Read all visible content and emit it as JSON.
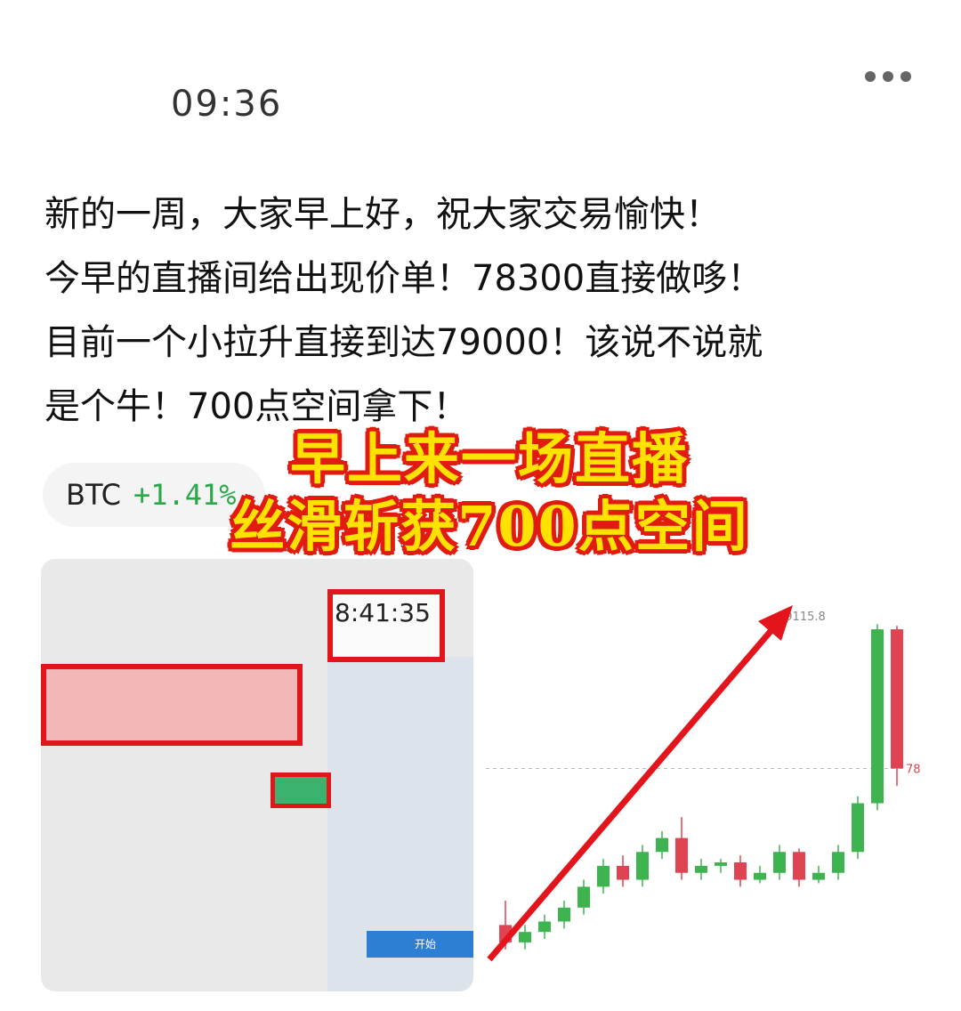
{
  "post": {
    "time": "09:36",
    "lines": [
      "新的一周，大家早上好，祝大家交易愉快！",
      "今早的直播间给出现价单！78300直接做哆！",
      "目前一个小拉升直接到达79000！该说不说就",
      "是个牛！700点空间拿下！"
    ]
  },
  "ticker": {
    "symbol": "BTC",
    "change": "+1.41%",
    "change_color": "#2aa84a"
  },
  "overlay": {
    "line1": "早上来一场直播",
    "line2": "丝滑斩获700点空间",
    "fill_color": "#ffe200",
    "stroke_color": "#e21b10"
  },
  "photo": {
    "clock": "8:41:35",
    "button": "开始"
  },
  "chart_data": {
    "type": "candlestick",
    "title": "",
    "xlabel": "",
    "ylabel": "",
    "high_label": "79115.8",
    "current_price_label": "78",
    "candles": [
      {
        "o": 78250,
        "c": 78200,
        "h": 78320,
        "l": 78180
      },
      {
        "o": 78200,
        "c": 78230,
        "h": 78250,
        "l": 78180
      },
      {
        "o": 78230,
        "c": 78260,
        "h": 78280,
        "l": 78210
      },
      {
        "o": 78260,
        "c": 78300,
        "h": 78320,
        "l": 78240
      },
      {
        "o": 78300,
        "c": 78360,
        "h": 78380,
        "l": 78280
      },
      {
        "o": 78360,
        "c": 78420,
        "h": 78440,
        "l": 78340
      },
      {
        "o": 78420,
        "c": 78380,
        "h": 78450,
        "l": 78360
      },
      {
        "o": 78380,
        "c": 78460,
        "h": 78480,
        "l": 78360
      },
      {
        "o": 78460,
        "c": 78500,
        "h": 78520,
        "l": 78440
      },
      {
        "o": 78500,
        "c": 78400,
        "h": 78560,
        "l": 78380
      },
      {
        "o": 78400,
        "c": 78420,
        "h": 78440,
        "l": 78380
      },
      {
        "o": 78420,
        "c": 78430,
        "h": 78440,
        "l": 78400
      },
      {
        "o": 78430,
        "c": 78380,
        "h": 78450,
        "l": 78360
      },
      {
        "o": 78380,
        "c": 78400,
        "h": 78420,
        "l": 78370
      },
      {
        "o": 78400,
        "c": 78460,
        "h": 78480,
        "l": 78380
      },
      {
        "o": 78460,
        "c": 78380,
        "h": 78470,
        "l": 78360
      },
      {
        "o": 78380,
        "c": 78400,
        "h": 78420,
        "l": 78370
      },
      {
        "o": 78400,
        "c": 78460,
        "h": 78480,
        "l": 78380
      },
      {
        "o": 78460,
        "c": 78600,
        "h": 78620,
        "l": 78440
      },
      {
        "o": 78600,
        "c": 79100,
        "h": 79115,
        "l": 78580
      },
      {
        "o": 79100,
        "c": 78700,
        "h": 79110,
        "l": 78650
      }
    ],
    "annotation": "red arrow up"
  }
}
